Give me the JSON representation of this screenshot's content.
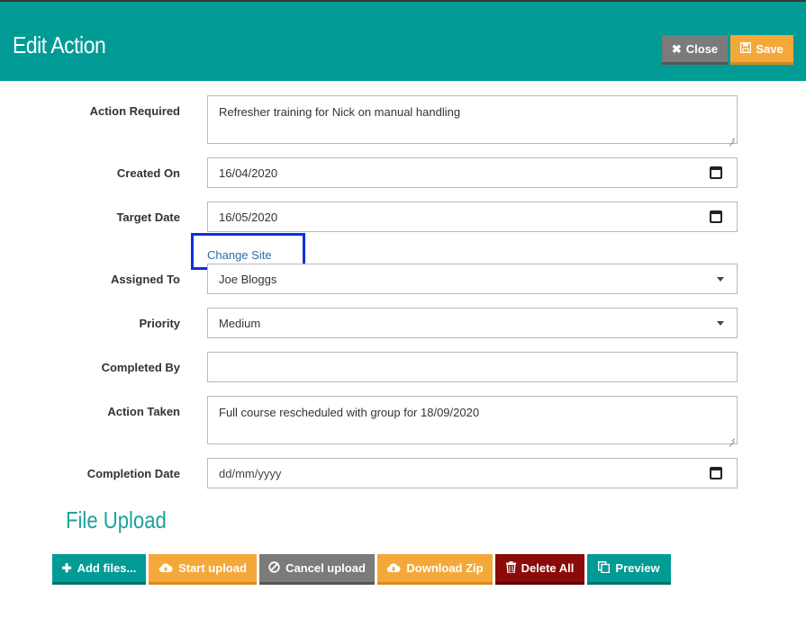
{
  "header": {
    "title": "Edit Action",
    "close_label": "Close",
    "save_label": "Save"
  },
  "form": {
    "action_required": {
      "label": "Action Required",
      "value": "Refresher training for Nick on manual handling"
    },
    "created_on": {
      "label": "Created On",
      "value": "16/04/2020"
    },
    "target_date": {
      "label": "Target Date",
      "value": "16/05/2020"
    },
    "change_site_link": "Change Site",
    "assigned_to": {
      "label": "Assigned To",
      "value": "Joe Bloggs"
    },
    "priority": {
      "label": "Priority",
      "value": "Medium"
    },
    "completed_by": {
      "label": "Completed By",
      "value": ""
    },
    "action_taken": {
      "label": "Action Taken",
      "value": "Full course rescheduled with group for 18/09/2020"
    },
    "completion_date": {
      "label": "Completion Date",
      "placeholder": "dd/mm/yyyy"
    }
  },
  "file_upload": {
    "title": "File Upload",
    "buttons": {
      "add_files": "Add files...",
      "start_upload": "Start upload",
      "cancel_upload": "Cancel upload",
      "download_zip": "Download Zip",
      "delete_all": "Delete All",
      "preview": "Preview"
    }
  },
  "colors": {
    "header_bg": "#009b95",
    "accent_orange": "#f5a83a",
    "gray": "#7b7b7b",
    "danger": "#8b0a0a",
    "highlight_box": "#0d2fe0"
  },
  "icons": {
    "close": "times-icon",
    "save": "floppy-icon",
    "date": "calendar-icon",
    "select": "caret-down-icon",
    "add": "plus-icon",
    "upload": "cloud-upload-icon",
    "cancel": "ban-icon",
    "download": "cloud-download-icon",
    "delete": "trash-icon",
    "preview": "copy-icon"
  }
}
